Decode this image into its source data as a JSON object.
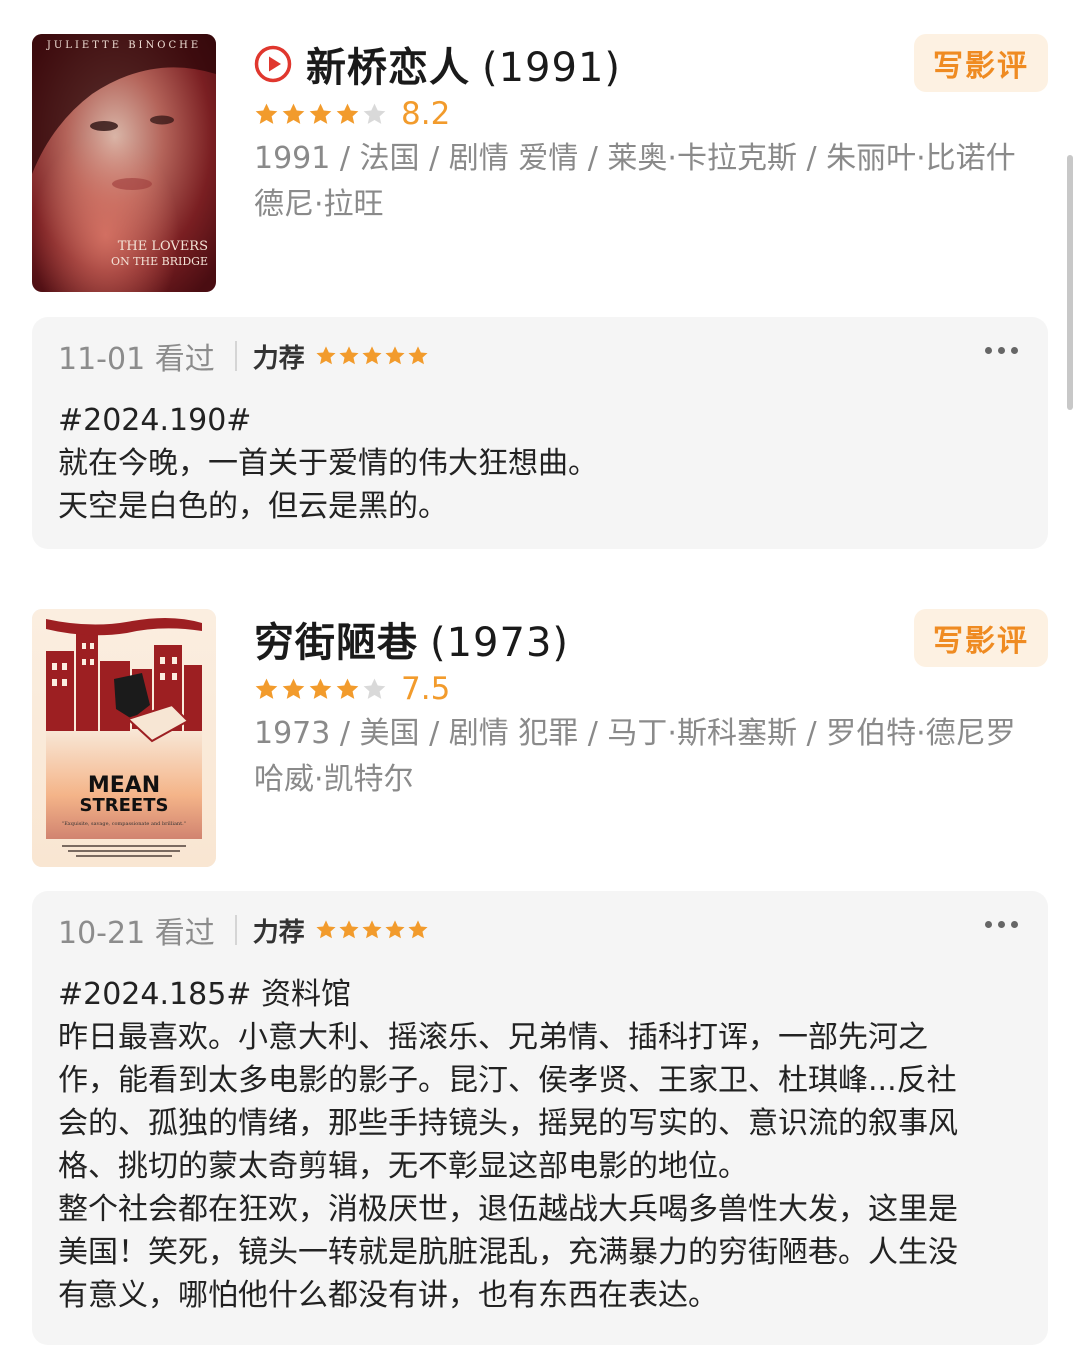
{
  "movies": [
    {
      "title": "新桥恋人",
      "year": "(1991)",
      "show_play_icon": true,
      "review_button": "写影评",
      "stars": 4,
      "score": "8.2",
      "meta_lines": [
        "1991 / 法国 / 剧情 爱情 / 莱奥·卡拉克斯 / 朱丽叶·比诺什",
        "德尼·拉旺"
      ],
      "poster": {
        "icon": "movie-poster-lovers-on-the-bridge",
        "top_text": "JULIETTE BINOCHE",
        "title_line1": "THE LOVERS",
        "title_line2": "ON THE BRIDGE"
      },
      "review": {
        "watched": "11-01 看过",
        "recommend": "力荐",
        "stars": 5,
        "lines": [
          "#2024.190#",
          "就在今晚，一首关于爱情的伟大狂想曲。",
          "天空是白色的，但云是黑的。"
        ]
      }
    },
    {
      "title": "穷街陋巷",
      "year": "(1973)",
      "show_play_icon": false,
      "review_button": "写影评",
      "stars": 4,
      "score": "7.5",
      "meta_lines": [
        "1973 / 美国 / 剧情 犯罪 / 马丁·斯科塞斯 / 罗伯特·德尼罗",
        "哈威·凯特尔"
      ],
      "poster": {
        "icon": "movie-poster-mean-streets",
        "title_line1": "MEAN",
        "title_line2": "STREETS",
        "tagline": "\"Exquisite, savage, compassionate and brilliant.\""
      },
      "review": {
        "watched": "10-21 看过",
        "recommend": "力荐",
        "stars": 5,
        "lines": [
          "#2024.185# 资料馆",
          "昨日最喜欢。小意大利、摇滚乐、兄弟情、插科打诨，一部先河之",
          "作，能看到太多电影的影子。昆汀、侯孝贤、王家卫、杜琪峰...反社",
          "会的、孤独的情绪，那些手持镜头，摇晃的写实的、意识流的叙事风",
          "格、挑切的蒙太奇剪辑，无不彰显这部电影的地位。",
          "整个社会都在狂欢，消极厌世，退伍越战大兵喝多兽性大发，这里是",
          "美国！笑死，镜头一转就是肮脏混乱，充满暴力的穷街陋巷。人生没",
          "有意义，哪怕他什么都没有讲，也有东西在表达。"
        ]
      }
    }
  ],
  "colors": {
    "star": "#f29b2c",
    "star_empty": "#d9d9d9",
    "button_bg": "#fdf1e2",
    "button_text": "#ef8b22",
    "card_bg": "#f5f5f5",
    "play_icon": "#e0372e"
  }
}
